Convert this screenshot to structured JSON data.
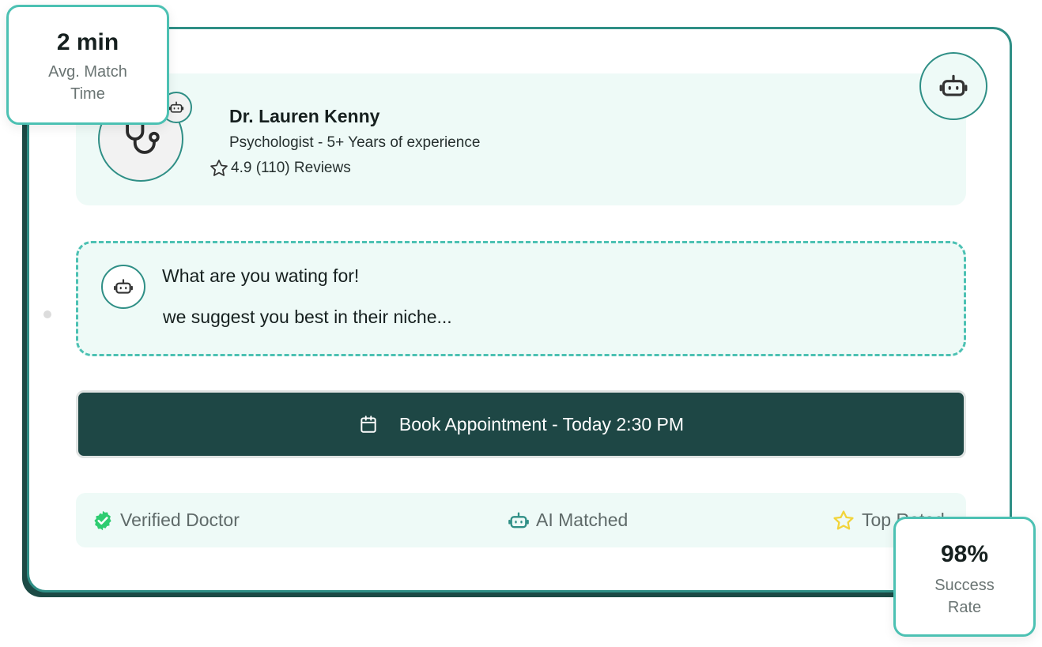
{
  "doctor": {
    "name": "Dr. Lauren Kenny",
    "specialty": "Psychologist -  5+ Years of experience",
    "rating": "4.9 (110) Reviews"
  },
  "message": {
    "line1": "What are you wating for!",
    "line2": "we suggest you best in their niche..."
  },
  "booking": {
    "label": "Book Appointment - Today 2:30 PM"
  },
  "badges": [
    {
      "label": "Verified Doctor",
      "icon": "verified-check-icon"
    },
    {
      "label": "AI Matched",
      "icon": "robot-icon"
    },
    {
      "label": "Top Rated",
      "icon": "star-icon"
    }
  ],
  "stats": {
    "match_time": {
      "value": "2 min",
      "label_line1": "Avg. Match",
      "label_line2": "Time"
    },
    "success_rate": {
      "value": "98%",
      "label_line1": "Success",
      "label_line2": "Rate"
    }
  },
  "colors": {
    "accent": "#2f8f86",
    "accent_light": "#4cc1b3",
    "panel_bg": "#eefaf7",
    "button_bg": "#1e4745",
    "verified_green": "#2ecc71",
    "star_yellow": "#f2d43a"
  }
}
